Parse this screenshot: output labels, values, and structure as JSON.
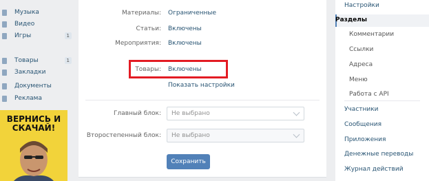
{
  "left_nav": {
    "items": [
      {
        "label": "Музыка",
        "icon": "music-icon",
        "count": ""
      },
      {
        "label": "Видео",
        "icon": "video-icon",
        "count": ""
      },
      {
        "label": "Игры",
        "icon": "games-icon",
        "count": "1"
      },
      {
        "label": "Товары",
        "icon": "goods-icon",
        "count": "1"
      },
      {
        "label": "Закладки",
        "icon": "bookmark-icon",
        "count": ""
      },
      {
        "label": "Документы",
        "icon": "documents-icon",
        "count": ""
      },
      {
        "label": "Реклама",
        "icon": "ads-icon",
        "count": ""
      }
    ],
    "ad": {
      "text": "ВЕРНИСЬ И СКАЧАЙ!"
    }
  },
  "main": {
    "rows": [
      {
        "label": "Материалы:",
        "value": "Ограниченные"
      },
      {
        "label": "Статьи:",
        "value": "Включены"
      },
      {
        "label": "Мероприятия:",
        "value": "Включены"
      },
      {
        "label": "Товары:",
        "value": "Включены"
      }
    ],
    "show_settings_link": "Показать настройки",
    "main_block": {
      "label": "Главный блок:",
      "value": "Не выбрано"
    },
    "secondary_block": {
      "label": "Второстепенный блок:",
      "value": "Не выбрано"
    },
    "save_button": "Сохранить"
  },
  "right_menu": {
    "items": [
      {
        "label": "Настройки",
        "type": "top"
      },
      {
        "label": "Разделы",
        "type": "active"
      },
      {
        "label": "Комментарии",
        "type": "sub"
      },
      {
        "label": "Ссылки",
        "type": "sub"
      },
      {
        "label": "Адреса",
        "type": "sub"
      },
      {
        "label": "Меню",
        "type": "sub"
      },
      {
        "label": "Работа с API",
        "type": "sub"
      },
      {
        "label": "Участники",
        "type": "top"
      },
      {
        "label": "Сообщения",
        "type": "top"
      },
      {
        "label": "Приложения",
        "type": "top"
      },
      {
        "label": "Денежные переводы",
        "type": "top"
      },
      {
        "label": "Журнал действий",
        "type": "top"
      }
    ]
  },
  "colors": {
    "link": "#285473",
    "accent": "#5181b8",
    "highlight": "#e31b23",
    "page_bg": "#edeef0"
  }
}
